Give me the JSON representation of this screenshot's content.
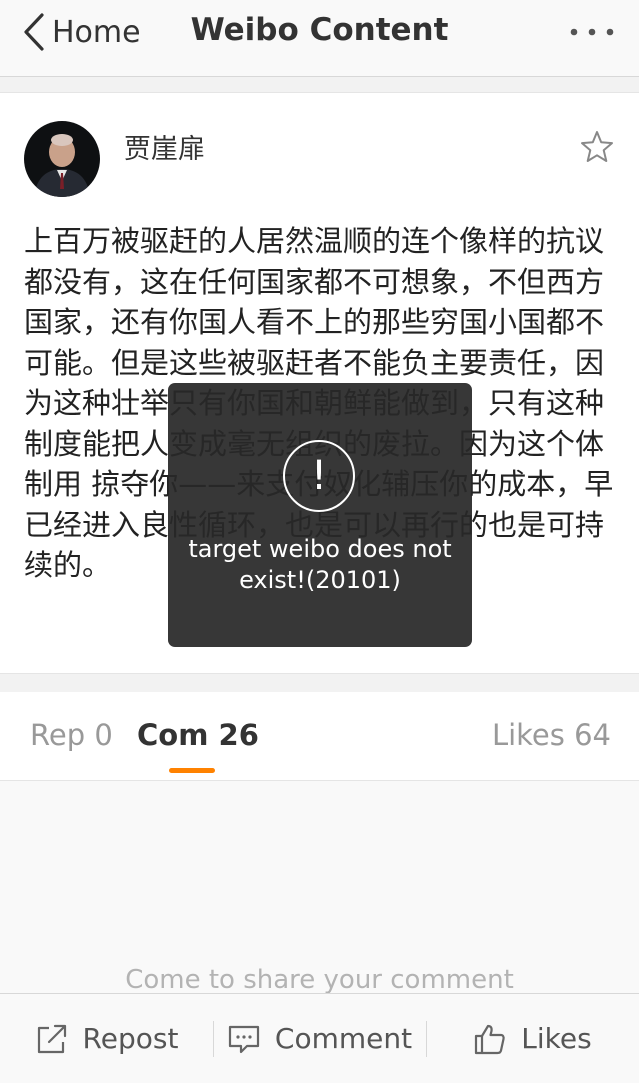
{
  "nav": {
    "back_label": "Home",
    "title": "Weibo Content",
    "more_icon": "more-dots-icon"
  },
  "post": {
    "username": "贾崖扉",
    "text": "上百万被驱赶的人居然温顺的连个像样的抗议都没有，这在任何国家都不可想象，不但西方国家，还有你国人看不上的那些穷国小国都不可能。但是这些被驱赶者不能负主要责任，因为这种壮举只有你国和朝鲜能做到，只有这种制度能把人变成毫无组织的废拉。因为这个体制用 掠夺你——来支付奴化辅压你的成本，早已经进入良性循环，也是可以再行的也是可持续的。",
    "favorite_icon": "star-outline-icon"
  },
  "tabs": {
    "reposts": "Rep 0",
    "comments": "Com 26",
    "likes": "Likes 64"
  },
  "comments": {
    "empty_hint": "Come to share your comment"
  },
  "toolbar": {
    "repost": "Repost",
    "comment": "Comment",
    "likes": "Likes"
  },
  "toast": {
    "icon": "!",
    "message": "target weibo does not exist!(20101)"
  },
  "colors": {
    "accent": "#ff8200",
    "toast_bg": "#2a2a2a",
    "muted_text": "#999999"
  }
}
